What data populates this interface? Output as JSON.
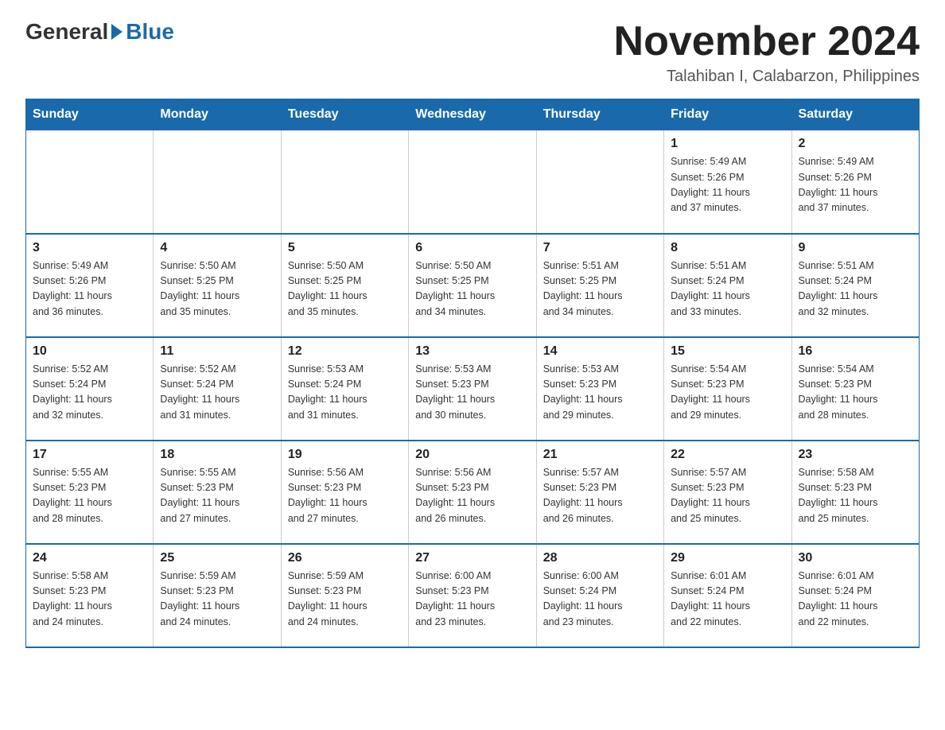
{
  "logo": {
    "general": "General",
    "triangle": "",
    "blue": "Blue"
  },
  "title": "November 2024",
  "subtitle": "Talahiban I, Calabarzon, Philippines",
  "days_header": [
    "Sunday",
    "Monday",
    "Tuesday",
    "Wednesday",
    "Thursday",
    "Friday",
    "Saturday"
  ],
  "weeks": [
    [
      {
        "day": "",
        "info": ""
      },
      {
        "day": "",
        "info": ""
      },
      {
        "day": "",
        "info": ""
      },
      {
        "day": "",
        "info": ""
      },
      {
        "day": "",
        "info": ""
      },
      {
        "day": "1",
        "info": "Sunrise: 5:49 AM\nSunset: 5:26 PM\nDaylight: 11 hours\nand 37 minutes."
      },
      {
        "day": "2",
        "info": "Sunrise: 5:49 AM\nSunset: 5:26 PM\nDaylight: 11 hours\nand 37 minutes."
      }
    ],
    [
      {
        "day": "3",
        "info": "Sunrise: 5:49 AM\nSunset: 5:26 PM\nDaylight: 11 hours\nand 36 minutes."
      },
      {
        "day": "4",
        "info": "Sunrise: 5:50 AM\nSunset: 5:25 PM\nDaylight: 11 hours\nand 35 minutes."
      },
      {
        "day": "5",
        "info": "Sunrise: 5:50 AM\nSunset: 5:25 PM\nDaylight: 11 hours\nand 35 minutes."
      },
      {
        "day": "6",
        "info": "Sunrise: 5:50 AM\nSunset: 5:25 PM\nDaylight: 11 hours\nand 34 minutes."
      },
      {
        "day": "7",
        "info": "Sunrise: 5:51 AM\nSunset: 5:25 PM\nDaylight: 11 hours\nand 34 minutes."
      },
      {
        "day": "8",
        "info": "Sunrise: 5:51 AM\nSunset: 5:24 PM\nDaylight: 11 hours\nand 33 minutes."
      },
      {
        "day": "9",
        "info": "Sunrise: 5:51 AM\nSunset: 5:24 PM\nDaylight: 11 hours\nand 32 minutes."
      }
    ],
    [
      {
        "day": "10",
        "info": "Sunrise: 5:52 AM\nSunset: 5:24 PM\nDaylight: 11 hours\nand 32 minutes."
      },
      {
        "day": "11",
        "info": "Sunrise: 5:52 AM\nSunset: 5:24 PM\nDaylight: 11 hours\nand 31 minutes."
      },
      {
        "day": "12",
        "info": "Sunrise: 5:53 AM\nSunset: 5:24 PM\nDaylight: 11 hours\nand 31 minutes."
      },
      {
        "day": "13",
        "info": "Sunrise: 5:53 AM\nSunset: 5:23 PM\nDaylight: 11 hours\nand 30 minutes."
      },
      {
        "day": "14",
        "info": "Sunrise: 5:53 AM\nSunset: 5:23 PM\nDaylight: 11 hours\nand 29 minutes."
      },
      {
        "day": "15",
        "info": "Sunrise: 5:54 AM\nSunset: 5:23 PM\nDaylight: 11 hours\nand 29 minutes."
      },
      {
        "day": "16",
        "info": "Sunrise: 5:54 AM\nSunset: 5:23 PM\nDaylight: 11 hours\nand 28 minutes."
      }
    ],
    [
      {
        "day": "17",
        "info": "Sunrise: 5:55 AM\nSunset: 5:23 PM\nDaylight: 11 hours\nand 28 minutes."
      },
      {
        "day": "18",
        "info": "Sunrise: 5:55 AM\nSunset: 5:23 PM\nDaylight: 11 hours\nand 27 minutes."
      },
      {
        "day": "19",
        "info": "Sunrise: 5:56 AM\nSunset: 5:23 PM\nDaylight: 11 hours\nand 27 minutes."
      },
      {
        "day": "20",
        "info": "Sunrise: 5:56 AM\nSunset: 5:23 PM\nDaylight: 11 hours\nand 26 minutes."
      },
      {
        "day": "21",
        "info": "Sunrise: 5:57 AM\nSunset: 5:23 PM\nDaylight: 11 hours\nand 26 minutes."
      },
      {
        "day": "22",
        "info": "Sunrise: 5:57 AM\nSunset: 5:23 PM\nDaylight: 11 hours\nand 25 minutes."
      },
      {
        "day": "23",
        "info": "Sunrise: 5:58 AM\nSunset: 5:23 PM\nDaylight: 11 hours\nand 25 minutes."
      }
    ],
    [
      {
        "day": "24",
        "info": "Sunrise: 5:58 AM\nSunset: 5:23 PM\nDaylight: 11 hours\nand 24 minutes."
      },
      {
        "day": "25",
        "info": "Sunrise: 5:59 AM\nSunset: 5:23 PM\nDaylight: 11 hours\nand 24 minutes."
      },
      {
        "day": "26",
        "info": "Sunrise: 5:59 AM\nSunset: 5:23 PM\nDaylight: 11 hours\nand 24 minutes."
      },
      {
        "day": "27",
        "info": "Sunrise: 6:00 AM\nSunset: 5:23 PM\nDaylight: 11 hours\nand 23 minutes."
      },
      {
        "day": "28",
        "info": "Sunrise: 6:00 AM\nSunset: 5:24 PM\nDaylight: 11 hours\nand 23 minutes."
      },
      {
        "day": "29",
        "info": "Sunrise: 6:01 AM\nSunset: 5:24 PM\nDaylight: 11 hours\nand 22 minutes."
      },
      {
        "day": "30",
        "info": "Sunrise: 6:01 AM\nSunset: 5:24 PM\nDaylight: 11 hours\nand 22 minutes."
      }
    ]
  ]
}
